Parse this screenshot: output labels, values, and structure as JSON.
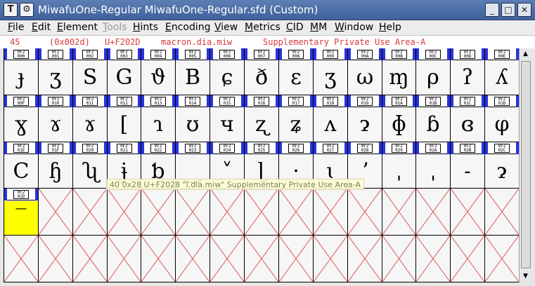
{
  "window": {
    "title": "MiwafuOne-Regular  MiwafuOne-Regular.sfd (Custom)",
    "app_icon_glyph": "T",
    "menu_icon_glyph": "⚙",
    "min_glyph": "_",
    "max_glyph": "□",
    "close_glyph": "✕"
  },
  "menu": [
    {
      "label": "File",
      "ul": "F",
      "rest": "ile",
      "disabled": false
    },
    {
      "label": "Edit",
      "ul": "E",
      "rest": "dit",
      "disabled": false
    },
    {
      "label": "Element",
      "ul": "E",
      "rest": "lement",
      "disabled": false
    },
    {
      "label": "Tools",
      "ul": "T",
      "rest": "ools",
      "disabled": true
    },
    {
      "label": "Hints",
      "ul": "H",
      "rest": "ints",
      "disabled": false
    },
    {
      "label": "Encoding",
      "ul": "E",
      "rest": "ncoding",
      "disabled": false
    },
    {
      "label": "View",
      "ul": "V",
      "rest": "iew",
      "disabled": false
    },
    {
      "label": "Metrics",
      "ul": "M",
      "rest": "etrics",
      "disabled": false
    },
    {
      "label": "CID",
      "ul": "C",
      "rest": "ID",
      "disabled": false
    },
    {
      "label": "MM",
      "ul": "M",
      "rest": "M",
      "disabled": false
    },
    {
      "label": "Window",
      "ul": "W",
      "rest": "indow",
      "disabled": false
    },
    {
      "label": "Help",
      "ul": "H",
      "rest": "elp",
      "disabled": false
    }
  ],
  "info": {
    "index": "45",
    "code": "(0x002d)",
    "unicode": "U+F202D",
    "glyph_name": "macron.dia.miw",
    "block": "Supplementary Private Use Area-A"
  },
  "tooltip": "40 0x28 U+F2028 \"l.dia.miw\" Supplementary Private Use Area-A",
  "rows": [
    {
      "cells": [
        {
          "code": [
            "0F2",
            "000"
          ],
          "glyph": "ɟ"
        },
        {
          "code": [
            "0F2",
            "001"
          ],
          "glyph": "ʒ"
        },
        {
          "code": [
            "0F2",
            "002"
          ],
          "glyph": "S"
        },
        {
          "code": [
            "0F2",
            "003"
          ],
          "glyph": "G"
        },
        {
          "code": [
            "0F2",
            "004"
          ],
          "glyph": "ϑ"
        },
        {
          "code": [
            "0F2",
            "005"
          ],
          "glyph": "B"
        },
        {
          "code": [
            "0F2",
            "006"
          ],
          "glyph": "ɕ"
        },
        {
          "code": [
            "0F2",
            "007"
          ],
          "glyph": "ð"
        },
        {
          "code": [
            "0F2",
            "008"
          ],
          "glyph": "ɛ"
        },
        {
          "code": [
            "0F2",
            "009"
          ],
          "glyph": "ʒ"
        },
        {
          "code": [
            "0F2",
            "00A"
          ],
          "glyph": "ω"
        },
        {
          "code": [
            "0F2",
            "00B"
          ],
          "glyph": "ɱ"
        },
        {
          "code": [
            "0F2",
            "00C"
          ],
          "glyph": "ρ"
        },
        {
          "code": [
            "0F2",
            "00D"
          ],
          "glyph": "ʔ"
        },
        {
          "code": [
            "0F2",
            "00E"
          ],
          "glyph": "ʎ"
        }
      ]
    },
    {
      "cells": [
        {
          "code": [
            "0F2",
            "00F"
          ],
          "glyph": "ɣ"
        },
        {
          "code": [
            "0F2",
            "010"
          ],
          "glyph": "ɤ"
        },
        {
          "code": [
            "0F2",
            "011"
          ],
          "glyph": "ɤ"
        },
        {
          "code": [
            "0F2",
            "012"
          ],
          "glyph": "[ "
        },
        {
          "code": [
            "0F2",
            "013"
          ],
          "glyph": "ɿ"
        },
        {
          "code": [
            "0F2",
            "014"
          ],
          "glyph": "ʊ"
        },
        {
          "code": [
            "0F2",
            "015"
          ],
          "glyph": "ч"
        },
        {
          "code": [
            "0F2",
            "016"
          ],
          "glyph": "ʐ"
        },
        {
          "code": [
            "0F2",
            "017"
          ],
          "glyph": "ʑ"
        },
        {
          "code": [
            "0F2",
            "018"
          ],
          "glyph": "ʌ"
        },
        {
          "code": [
            "0F2",
            "019"
          ],
          "glyph": "ɂ"
        },
        {
          "code": [
            "0F2",
            "01A"
          ],
          "glyph": "ɸ"
        },
        {
          "code": [
            "0F2",
            "01B"
          ],
          "glyph": "ɓ"
        },
        {
          "code": [
            "0F2",
            "01C"
          ],
          "glyph": "ɞ"
        },
        {
          "code": [
            "0F2",
            "01D"
          ],
          "glyph": "φ"
        }
      ]
    },
    {
      "cells": [
        {
          "code": [
            "0F2",
            "01E"
          ],
          "glyph": "C"
        },
        {
          "code": [
            "0F2",
            "01F"
          ],
          "glyph": "ɧ"
        },
        {
          "code": [
            "0F2",
            "020"
          ],
          "glyph": "ʯ"
        },
        {
          "code": [
            "0F2",
            "021"
          ],
          "glyph": "ɉ"
        },
        {
          "code": [
            "0F2",
            "022"
          ],
          "glyph": "ƅ"
        },
        {
          "code": [
            "0F2",
            "023"
          ],
          "glyph": "‿"
        },
        {
          "code": [
            "0F2",
            "024"
          ],
          "glyph": "˅"
        },
        {
          "code": [
            "0F2",
            "025"
          ],
          "glyph": "ɭ"
        },
        {
          "code": [
            "0F2",
            "026"
          ],
          "glyph": "·"
        },
        {
          "code": [
            "0F2",
            "027"
          ],
          "glyph": "ɩ"
        },
        {
          "code": [
            "0F2",
            "028"
          ],
          "glyph": "ʼ"
        },
        {
          "code": [
            "0F2",
            "029"
          ],
          "glyph": "ˌ"
        },
        {
          "code": [
            "0F2",
            "02A"
          ],
          "glyph": "ˌ"
        },
        {
          "code": [
            "0F2",
            "02B"
          ],
          "glyph": "˗"
        },
        {
          "code": [
            "0F2",
            "02C"
          ],
          "glyph": "ɂ"
        }
      ]
    },
    {
      "cells": [
        {
          "code": [
            "0F2",
            "02D"
          ],
          "glyph": "‾",
          "selected": true
        }
      ]
    }
  ],
  "scrollbar": {
    "up": "▲",
    "down": "▼"
  }
}
